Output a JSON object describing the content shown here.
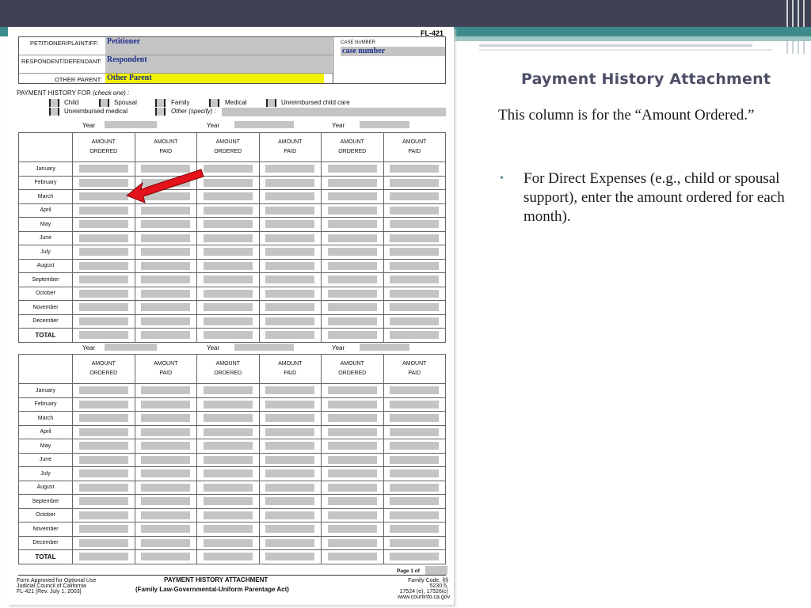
{
  "slide": {
    "title": "Payment History Attachment",
    "intro": "This column is for the “Amount Ordered.”",
    "bullet": "For Direct Expenses (e.g., child or spousal support), enter the amount ordered for each month)."
  },
  "form": {
    "form_number": "FL-421",
    "petitioner_label": "PETITIONER/PLAINTIFF:",
    "petitioner_value": "Petitioner",
    "respondent_label": "RESPONDENT/DEFENDANT:",
    "respondent_value": "Respondent",
    "other_parent_label": "OTHER PARENT:",
    "other_parent_value": "Other Parent",
    "case_number_label": "CASE NUMBER",
    "case_number_value": "case number",
    "history_for_label": "PAYMENT HISTORY FOR",
    "check_one": "(check one) :",
    "checkboxes": [
      "Child",
      "Spousal",
      "Family",
      "Medical",
      "Unreimbursed child care",
      "Unreimbursed medical",
      "Other (specify) :"
    ],
    "year_label": "Year",
    "col_headers": [
      {
        "top": "AMOUNT",
        "bottom": "ORDERED"
      },
      {
        "top": "AMOUNT",
        "bottom": "PAID"
      },
      {
        "top": "AMOUNT",
        "bottom": "ORDERED"
      },
      {
        "top": "AMOUNT",
        "bottom": "PAID"
      },
      {
        "top": "AMOUNT",
        "bottom": "ORDERED"
      },
      {
        "top": "AMOUNT",
        "bottom": "PAID"
      }
    ],
    "months": [
      "January",
      "February",
      "March",
      "April",
      "May",
      "June",
      "July",
      "August",
      "September",
      "October",
      "November",
      "December"
    ],
    "total_label": "TOTAL",
    "page_label": "Page 1 of",
    "footer_left": [
      "Form Approved for Optional Use",
      "Judicial Council of California",
      "FL-421 [Rev. July 1, 2003]"
    ],
    "footer_title": "PAYMENT HISTORY ATTACHMENT",
    "footer_subtitle": "(Family Law-Governmental-Uniform Parentage Act)",
    "footer_right": [
      "Family Code, §§ 5230.5,",
      "17524 (e), 17526(c)",
      "www.courtinfo.ca.gov"
    ]
  },
  "colors": {
    "topbar": "#3f4254",
    "accent": "#3d8a8b",
    "arrow": "#e3121b",
    "highlight": "#f2f200",
    "field_gray": "#c4c4c4"
  }
}
